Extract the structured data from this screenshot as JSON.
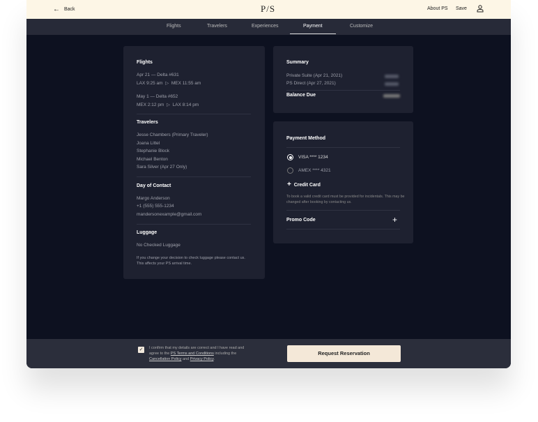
{
  "header": {
    "back": "Back",
    "logo": "P/S",
    "about": "About PS",
    "save": "Save"
  },
  "nav": {
    "tabs": [
      "Flights",
      "Travelers",
      "Experiences",
      "Payment",
      "Customize"
    ],
    "active": "Payment"
  },
  "left": {
    "flights_title": "Flights",
    "flight1": {
      "line1": "Apr 21 — Delta #631",
      "from": "LAX 9:25 am",
      "to": "MEX 11:55 am"
    },
    "flight2": {
      "line1": "May 1 — Delta #652",
      "from": "MEX 2:12 pm",
      "to": "LAX 8:14 pm"
    },
    "travelers_title": "Travelers",
    "travelers": [
      "Jesse Chambers (Primary Traveler)",
      "Joana Littel",
      "Stephanie Block",
      "Michael Benton",
      "Sara Silver (Apr 27 Only)"
    ],
    "contact_title": "Day of Contact",
    "contact": [
      "Margo Anderson",
      "+1 (555) 555-1234",
      "mandersonexample@gmail.com"
    ],
    "luggage_title": "Luggage",
    "luggage": "No Checked Luggage",
    "luggage_note": "If you change your decision to check luggage please contact us. This affects your PS arrival time."
  },
  "summary": {
    "title": "Summary",
    "items": [
      "Private Suite (Apr 21, 2021)",
      "PS Direct (Apr 27, 2021)"
    ],
    "balance": "Balance Due"
  },
  "payment": {
    "title": "Payment Method",
    "cards": [
      "VISA **** 1234",
      "AMEX **** 4321"
    ],
    "selected": "VISA **** 1234",
    "add": "Credit Card",
    "note": "To book a valid credit card must be provided for incidentals. This may be changed after booking by contacting us.",
    "promo": "Promo Code"
  },
  "footer": {
    "confirm1": "I confirm that my details are correct and I have read and agree to the ",
    "terms": "PS Terms and Conditions",
    "confirm2": " including the ",
    "cancel": "Cancellation Policy",
    "and": " and ",
    "privacy": "Privacy Policy",
    "end": ".",
    "checked": true,
    "button": "Request Reservation"
  }
}
